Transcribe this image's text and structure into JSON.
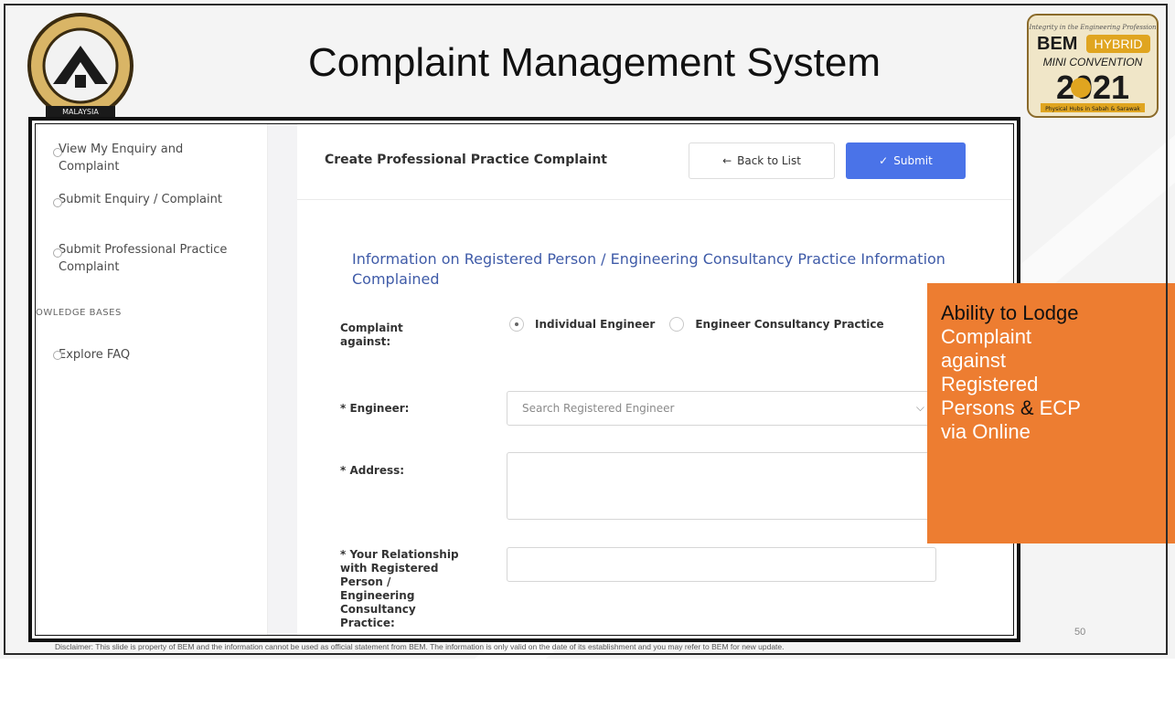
{
  "slide": {
    "title": "Complaint Management System",
    "page_number": "50",
    "disclaimer": "Disclaimer: This slide is property of BEM and the information cannot be used as official statement from BEM. The information is only valid on the date of its establishment and you may refer to BEM for new update."
  },
  "logo_left": {
    "text": "MALAYSIA"
  },
  "logo_right": {
    "tagline": "Integrity in the Engineering Profession",
    "line1": "BEM",
    "hybrid": "HYBRID",
    "line2": "MINI CONVENTION",
    "year": "2021",
    "footer": "Physical Hubs in Sabah & Sarawak"
  },
  "sidebar": {
    "items": [
      {
        "label": "View My Enquiry and Complaint"
      },
      {
        "label": "Submit Enquiry / Complaint"
      },
      {
        "label": "Submit Professional Practice Complaint"
      }
    ],
    "section": "OWLEDGE BASES",
    "faq": "Explore FAQ"
  },
  "form": {
    "title": "Create Professional Practice Complaint",
    "back_label": "Back to List",
    "submit_label": "Submit",
    "section_heading": "Information on Registered Person / Engineering Consultancy Practice Information Complained",
    "complaint_against_label": "Complaint against:",
    "radio_options": [
      "Individual Engineer",
      "Engineer Consultancy Practice"
    ],
    "selected_option": "Individual Engineer",
    "engineer_label": "* Engineer:",
    "engineer_placeholder": "Search Registered Engineer",
    "address_label": "* Address:",
    "relationship_label": "* Your Relationship with Registered Person / Engineering Consultancy Practice:"
  },
  "callout": {
    "line1": "Ability to Lodge",
    "line2": "Complaint",
    "line3": "against",
    "line4": "Registered",
    "line5a": "Persons ",
    "line5b": "&",
    "line5c": " ECP",
    "line6": "via Online"
  },
  "colors": {
    "accent": "#4a73e8",
    "heading": "#3f5ba8",
    "callout": "#ed7d31"
  }
}
